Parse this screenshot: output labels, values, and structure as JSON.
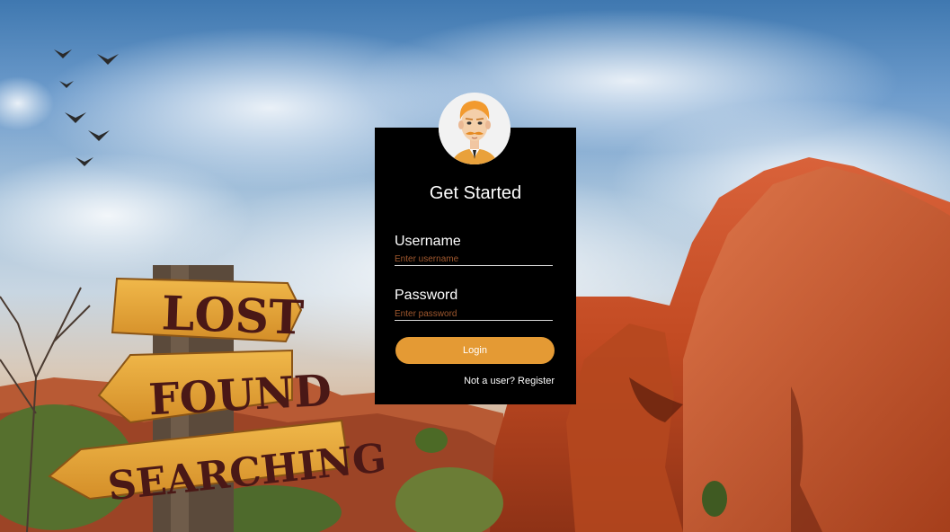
{
  "card": {
    "title": "Get Started",
    "username_label": "Username",
    "username_placeholder": "Enter username",
    "username_value": "",
    "password_label": "Password",
    "password_placeholder": "Enter password",
    "password_value": "",
    "login_label": "Login",
    "register_label": "Not a user? Register"
  },
  "background": {
    "signs": [
      "LOST",
      "FOUND",
      "SEARCHING"
    ]
  },
  "colors": {
    "card_bg": "#000000",
    "accent": "#e49a34",
    "placeholder": "#a0582e"
  },
  "icons": [
    "user-avatar-icon",
    "bird-icon"
  ]
}
